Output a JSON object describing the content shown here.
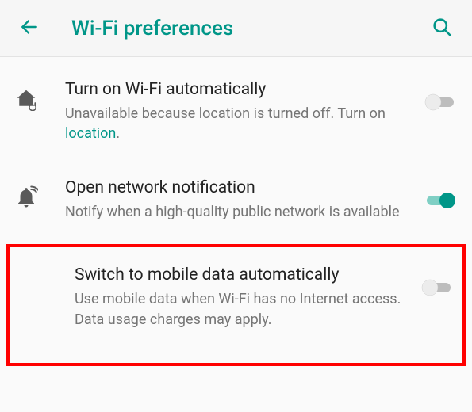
{
  "header": {
    "title": "Wi-Fi preferences"
  },
  "colors": {
    "accent": "#009688",
    "textPrimary": "#212121",
    "textSecondary": "#757575",
    "highlight": "#ff0000"
  },
  "items": [
    {
      "icon": "home-refresh",
      "title": "Turn on Wi-Fi automatically",
      "subPrefix": "Unavailable because location is turned off. Turn on ",
      "subLink": "location",
      "subSuffix": ".",
      "toggle": false
    },
    {
      "icon": "bell-wifi",
      "title": "Open network notification",
      "sub": "Notify when a high-quality public network is available",
      "toggle": true
    },
    {
      "title": "Switch to mobile data automatically",
      "sub": "Use mobile data when Wi-Fi has no Internet access. Data usage charges may apply.",
      "toggle": false,
      "highlighted": true
    }
  ],
  "icons": {
    "back": "arrow-back-icon",
    "search": "search-icon"
  }
}
